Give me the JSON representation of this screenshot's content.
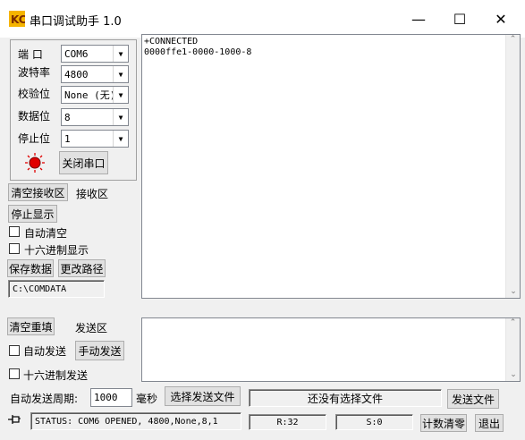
{
  "window": {
    "title": "串口调试助手 1.0",
    "controls": {
      "minimize": "—",
      "maximize": "☐",
      "close": "✕"
    }
  },
  "port_settings": {
    "port_label": "端  口",
    "port_value": "COM6",
    "baud_label": "波特率",
    "baud_value": "4800",
    "parity_label": "校验位",
    "parity_value": "None (无)",
    "databits_label": "数据位",
    "databits_value": "8",
    "stopbits_label": "停止位",
    "stopbits_value": "1",
    "toggle_port_button": "关闭串口"
  },
  "receive": {
    "clear_button": "清空接收区",
    "area_label": "接收区",
    "stop_display_button": "停止显示",
    "auto_clear_label": "自动清空",
    "hex_display_label": "十六进制显示",
    "save_data_button": "保存数据",
    "change_path_button": "更改路径",
    "save_path": "C:\\COMDATA",
    "lines": [
      "+CONNECTED",
      "0000ffe1-0000-1000-8"
    ]
  },
  "send": {
    "clear_resend_button": "清空重填",
    "area_label": "发送区",
    "auto_send_label": "自动发送",
    "manual_send_button": "手动发送",
    "hex_send_label": "十六进制发送",
    "period_label": "自动发送周期:",
    "period_value": "1000",
    "period_unit": "毫秒",
    "choose_file_button": "选择发送文件",
    "file_status": "还没有选择文件",
    "send_file_button": "发送文件"
  },
  "status": {
    "text": "STATUS: COM6 OPENED, 4800,None,8,1",
    "rx_count": "R:32",
    "tx_count": "S:0",
    "reset_count_button": "计数清零",
    "exit_button": "退出"
  },
  "colors": {
    "indicator": "#e00000"
  }
}
